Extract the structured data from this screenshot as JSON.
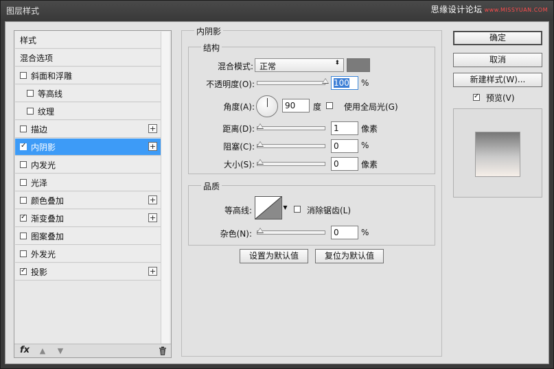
{
  "window": {
    "title": "图层样式",
    "watermark": "思缘设计论坛",
    "watermark_sub": "www.MISSYUAN.COM"
  },
  "left_panel": {
    "items": [
      {
        "label": "样式",
        "checkbox": false,
        "checked": false,
        "plus": false
      },
      {
        "label": "混合选项",
        "checkbox": false,
        "checked": false,
        "plus": false
      },
      {
        "label": "斜面和浮雕",
        "checkbox": true,
        "checked": false,
        "plus": false
      },
      {
        "label": "等高线",
        "checkbox": true,
        "checked": false,
        "plus": false,
        "indent": true
      },
      {
        "label": "纹理",
        "checkbox": true,
        "checked": false,
        "plus": false,
        "indent": true
      },
      {
        "label": "描边",
        "checkbox": true,
        "checked": false,
        "plus": true
      },
      {
        "label": "内阴影",
        "checkbox": true,
        "checked": true,
        "plus": true,
        "selected": true
      },
      {
        "label": "内发光",
        "checkbox": true,
        "checked": false,
        "plus": false
      },
      {
        "label": "光泽",
        "checkbox": true,
        "checked": false,
        "plus": false
      },
      {
        "label": "颜色叠加",
        "checkbox": true,
        "checked": false,
        "plus": true
      },
      {
        "label": "渐变叠加",
        "checkbox": true,
        "checked": true,
        "plus": true
      },
      {
        "label": "图案叠加",
        "checkbox": true,
        "checked": false,
        "plus": false
      },
      {
        "label": "外发光",
        "checkbox": true,
        "checked": false,
        "plus": false
      },
      {
        "label": "投影",
        "checkbox": true,
        "checked": true,
        "plus": true
      }
    ],
    "footer": {
      "fx_label": "fx"
    }
  },
  "inner_shadow": {
    "section_title": "内阴影",
    "structure": {
      "title": "结构",
      "blend_mode_label": "混合模式:",
      "blend_mode_value": "正常",
      "shadow_color": "#7b7b7b",
      "opacity_label": "不透明度(O):",
      "opacity_value": "100",
      "opacity_unit": "%",
      "angle_label": "角度(A):",
      "angle_value": "90",
      "angle_unit": "度",
      "global_light_label": "使用全局光(G)",
      "global_light_checked": false,
      "distance_label": "距离(D):",
      "distance_value": "1",
      "distance_unit": "像素",
      "choke_label": "阻塞(C):",
      "choke_value": "0",
      "choke_unit": "%",
      "size_label": "大小(S):",
      "size_value": "0",
      "size_unit": "像素"
    },
    "quality": {
      "title": "品质",
      "contour_label": "等高线:",
      "anti_alias_label": "消除锯齿(L)",
      "anti_alias_checked": false,
      "noise_label": "杂色(N):",
      "noise_value": "0",
      "noise_unit": "%"
    },
    "set_default_label": "设置为默认值",
    "reset_default_label": "复位为默认值"
  },
  "right_panel": {
    "ok_label": "确定",
    "cancel_label": "取消",
    "new_style_label": "新建样式(W)...",
    "preview_label": "预览(V)",
    "preview_checked": true
  }
}
